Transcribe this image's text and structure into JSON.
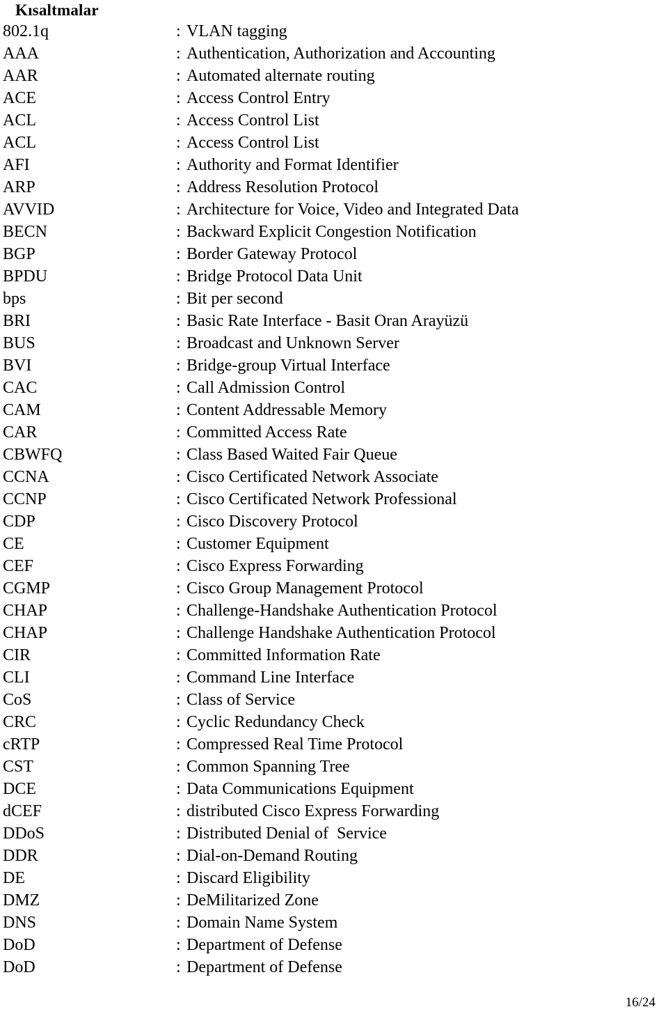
{
  "document": {
    "title": "Kısaltmalar",
    "separator": ":",
    "footer": "16/24"
  },
  "abbreviations": [
    {
      "term": "802.1q",
      "definition": "VLAN tagging"
    },
    {
      "term": "AAA",
      "definition": "Authentication, Authorization and Accounting"
    },
    {
      "term": "AAR",
      "definition": "Automated alternate routing"
    },
    {
      "term": "ACE",
      "definition": "Access Control Entry"
    },
    {
      "term": "ACL",
      "definition": "Access Control List"
    },
    {
      "term": "ACL",
      "definition": "Access Control List"
    },
    {
      "term": "AFI",
      "definition": "Authority and Format Identifier"
    },
    {
      "term": "ARP",
      "definition": "Address Resolution Protocol"
    },
    {
      "term": "AVVID",
      "definition": "Architecture for Voice, Video and Integrated Data"
    },
    {
      "term": "BECN",
      "definition": "Backward Explicit Congestion Notification"
    },
    {
      "term": "BGP",
      "definition": "Border Gateway Protocol"
    },
    {
      "term": "BPDU",
      "definition": "Bridge Protocol Data Unit"
    },
    {
      "term": "bps",
      "definition": "Bit per second"
    },
    {
      "term": "BRI",
      "definition": "Basic Rate Interface - Basit Oran Arayüzü"
    },
    {
      "term": "BUS",
      "definition": "Broadcast and Unknown Server"
    },
    {
      "term": "BVI",
      "definition": "Bridge-group Virtual Interface"
    },
    {
      "term": "CAC",
      "definition": "Call Admission Control"
    },
    {
      "term": "CAM",
      "definition": "Content Addressable Memory"
    },
    {
      "term": "CAR",
      "definition": "Committed Access Rate"
    },
    {
      "term": "CBWFQ",
      "definition": "Class Based Waited Fair Queue"
    },
    {
      "term": "CCNA",
      "definition": "Cisco Certificated Network Associate"
    },
    {
      "term": "CCNP",
      "definition": "Cisco Certificated Network Professional"
    },
    {
      "term": "CDP",
      "definition": "Cisco Discovery Protocol"
    },
    {
      "term": "CE",
      "definition": "Customer Equipment"
    },
    {
      "term": "CEF",
      "definition": "Cisco Express Forwarding"
    },
    {
      "term": "CGMP",
      "definition": "Cisco Group Management Protocol"
    },
    {
      "term": "CHAP",
      "definition": "Challenge-Handshake Authentication Protocol"
    },
    {
      "term": "CHAP",
      "definition": "Challenge Handshake Authentication Protocol"
    },
    {
      "term": "CIR",
      "definition": "Committed Information Rate"
    },
    {
      "term": "CLI",
      "definition": "Command Line Interface"
    },
    {
      "term": "CoS",
      "definition": "Class of Service"
    },
    {
      "term": "CRC",
      "definition": "Cyclic Redundancy Check"
    },
    {
      "term": "cRTP",
      "definition": "Compressed Real Time Protocol"
    },
    {
      "term": "CST",
      "definition": "Common Spanning Tree"
    },
    {
      "term": "DCE",
      "definition": "Data Communications Equipment"
    },
    {
      "term": "dCEF",
      "definition": "distributed Cisco Express Forwarding"
    },
    {
      "term": "DDoS",
      "definition": "Distributed Denial of  Service"
    },
    {
      "term": "DDR",
      "definition": "Dial-on-Demand Routing"
    },
    {
      "term": "DE",
      "definition": "Discard Eligibility"
    },
    {
      "term": "DMZ",
      "definition": "DeMilitarized Zone"
    },
    {
      "term": "DNS",
      "definition": "Domain Name System"
    },
    {
      "term": "DoD",
      "definition": "Department of Defense"
    },
    {
      "term": "DoD",
      "definition": "Department of Defense"
    }
  ]
}
